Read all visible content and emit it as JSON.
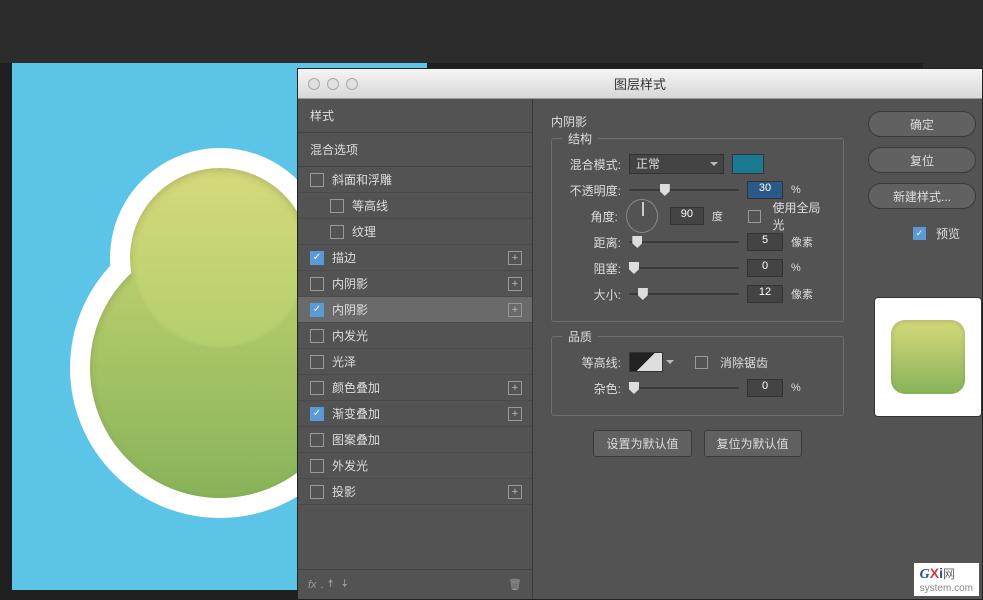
{
  "dialog": {
    "title": "图层样式"
  },
  "styles_panel": {
    "header_styles": "样式",
    "header_blend": "混合选项",
    "items": [
      {
        "label": "斜面和浮雕",
        "checked": false,
        "selected": false,
        "sub": false,
        "plus": false
      },
      {
        "label": "等高线",
        "checked": false,
        "selected": false,
        "sub": true,
        "plus": false
      },
      {
        "label": "纹理",
        "checked": false,
        "selected": false,
        "sub": true,
        "plus": false
      },
      {
        "label": "描边",
        "checked": true,
        "selected": false,
        "sub": false,
        "plus": true
      },
      {
        "label": "内阴影",
        "checked": false,
        "selected": false,
        "sub": false,
        "plus": true
      },
      {
        "label": "内阴影",
        "checked": true,
        "selected": true,
        "sub": false,
        "plus": true
      },
      {
        "label": "内发光",
        "checked": false,
        "selected": false,
        "sub": false,
        "plus": false
      },
      {
        "label": "光泽",
        "checked": false,
        "selected": false,
        "sub": false,
        "plus": false
      },
      {
        "label": "颜色叠加",
        "checked": false,
        "selected": false,
        "sub": false,
        "plus": true
      },
      {
        "label": "渐变叠加",
        "checked": true,
        "selected": false,
        "sub": false,
        "plus": true
      },
      {
        "label": "图案叠加",
        "checked": false,
        "selected": false,
        "sub": false,
        "plus": false
      },
      {
        "label": "外发光",
        "checked": false,
        "selected": false,
        "sub": false,
        "plus": false
      },
      {
        "label": "投影",
        "checked": false,
        "selected": false,
        "sub": false,
        "plus": true
      }
    ],
    "footer": {
      "fx": "fx",
      "trash": "🗑"
    }
  },
  "settings": {
    "title": "内阴影",
    "structure_legend": "结构",
    "blend_mode_label": "混合模式:",
    "blend_mode_value": "正常",
    "opacity_label": "不透明度:",
    "opacity_value": "30",
    "opacity_unit": "%",
    "angle_label": "角度:",
    "angle_value": "90",
    "angle_unit": "度",
    "global_light_label": "使用全局光",
    "distance_label": "距离:",
    "distance_value": "5",
    "distance_unit": "像素",
    "choke_label": "阻塞:",
    "choke_value": "0",
    "choke_unit": "%",
    "size_label": "大小:",
    "size_value": "12",
    "size_unit": "像素",
    "quality_legend": "品质",
    "contour_label": "等高线:",
    "antialias_label": "消除锯齿",
    "noise_label": "杂色:",
    "noise_value": "0",
    "noise_unit": "%",
    "make_default": "设置为默认值",
    "reset_default": "复位为默认值"
  },
  "right": {
    "ok": "确定",
    "reset": "复位",
    "new_style": "新建样式...",
    "preview": "预览"
  },
  "watermark": {
    "g": "G",
    "x": "X",
    "i": "i",
    "net": "网",
    "sub": "system.com"
  }
}
